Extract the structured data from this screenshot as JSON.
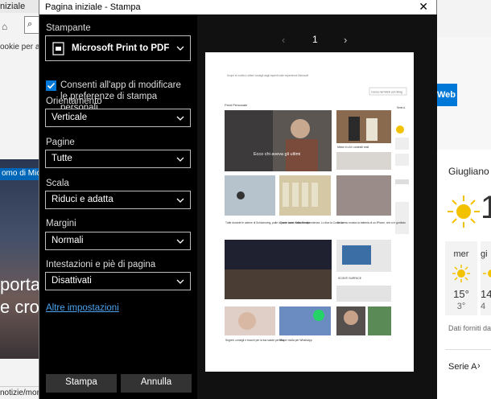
{
  "background": {
    "window_title": "niziale",
    "cookie_text": "ookie per an",
    "news_tag": "omo di Micro",
    "news_title_l1": "portare",
    "news_title_l2": "e cron",
    "status_url": "notizie/mond",
    "web_button": "Web",
    "weather_city": "Giugliano in",
    "weather_temp": "1",
    "forecast": [
      {
        "day": "mer",
        "hi": "15°",
        "lo": "3°"
      },
      {
        "day": "gi",
        "hi": "14",
        "lo": "4"
      }
    ],
    "weather_credit": "Dati forniti da Fi",
    "serie_label": "Serie A"
  },
  "dialog": {
    "title": "Pagina iniziale - Stampa",
    "close_glyph": "✕",
    "printer": {
      "label": "Stampante",
      "value": "Microsoft Print to PDF"
    },
    "allow_apps": "Consenti all'app di modificare le preferenze di stampa personali",
    "orientation": {
      "label": "Orientamento",
      "value": "Verticale"
    },
    "pages": {
      "label": "Pagine",
      "value": "Tutte"
    },
    "scale": {
      "label": "Scala",
      "value": "Riduci e adatta"
    },
    "margins": {
      "label": "Margini",
      "value": "Normali"
    },
    "header_footer": {
      "label": "Intestazioni e piè di pagina",
      "value": "Disattivati"
    },
    "more_settings": "Altre impostazioni",
    "print_button": "Stampa",
    "cancel_button": "Annulla",
    "preview": {
      "prev_glyph": "‹",
      "page_number": "1",
      "next_glyph": "›"
    }
  },
  "preview_page": {
    "header_text": "Scopri le novità e ottieni consigli dagli esperti sulle esperienze Microsoft",
    "search_button": "Cerca nel Web con Bing",
    "feed_label": "Feed Personale",
    "headline": "Ecco chi aveva gli ultimi",
    "caption_1": "Tutte durante le catene di Schlomming, palle di neve come Kristoffersen",
    "caption_2": "Quote Iacle, Italia è indipendenza. Lo dice la Corte Ue",
    "caption_3": "Un uomo mostra la batteria di un iPhone, che si è gonfiato",
    "caption_top": "Meloe in chi i contratti reali",
    "caption_mid": "SCONTI SURFACE",
    "caption_4": "Segreti, consigli e trucchi per la tua salute perfetta",
    "caption_5": "Super multa per WhatsApp",
    "side_title": "Serie A"
  },
  "colors": {
    "accent": "#0078d7",
    "dialog_bg": "#000000",
    "link": "#4aa3f0"
  }
}
